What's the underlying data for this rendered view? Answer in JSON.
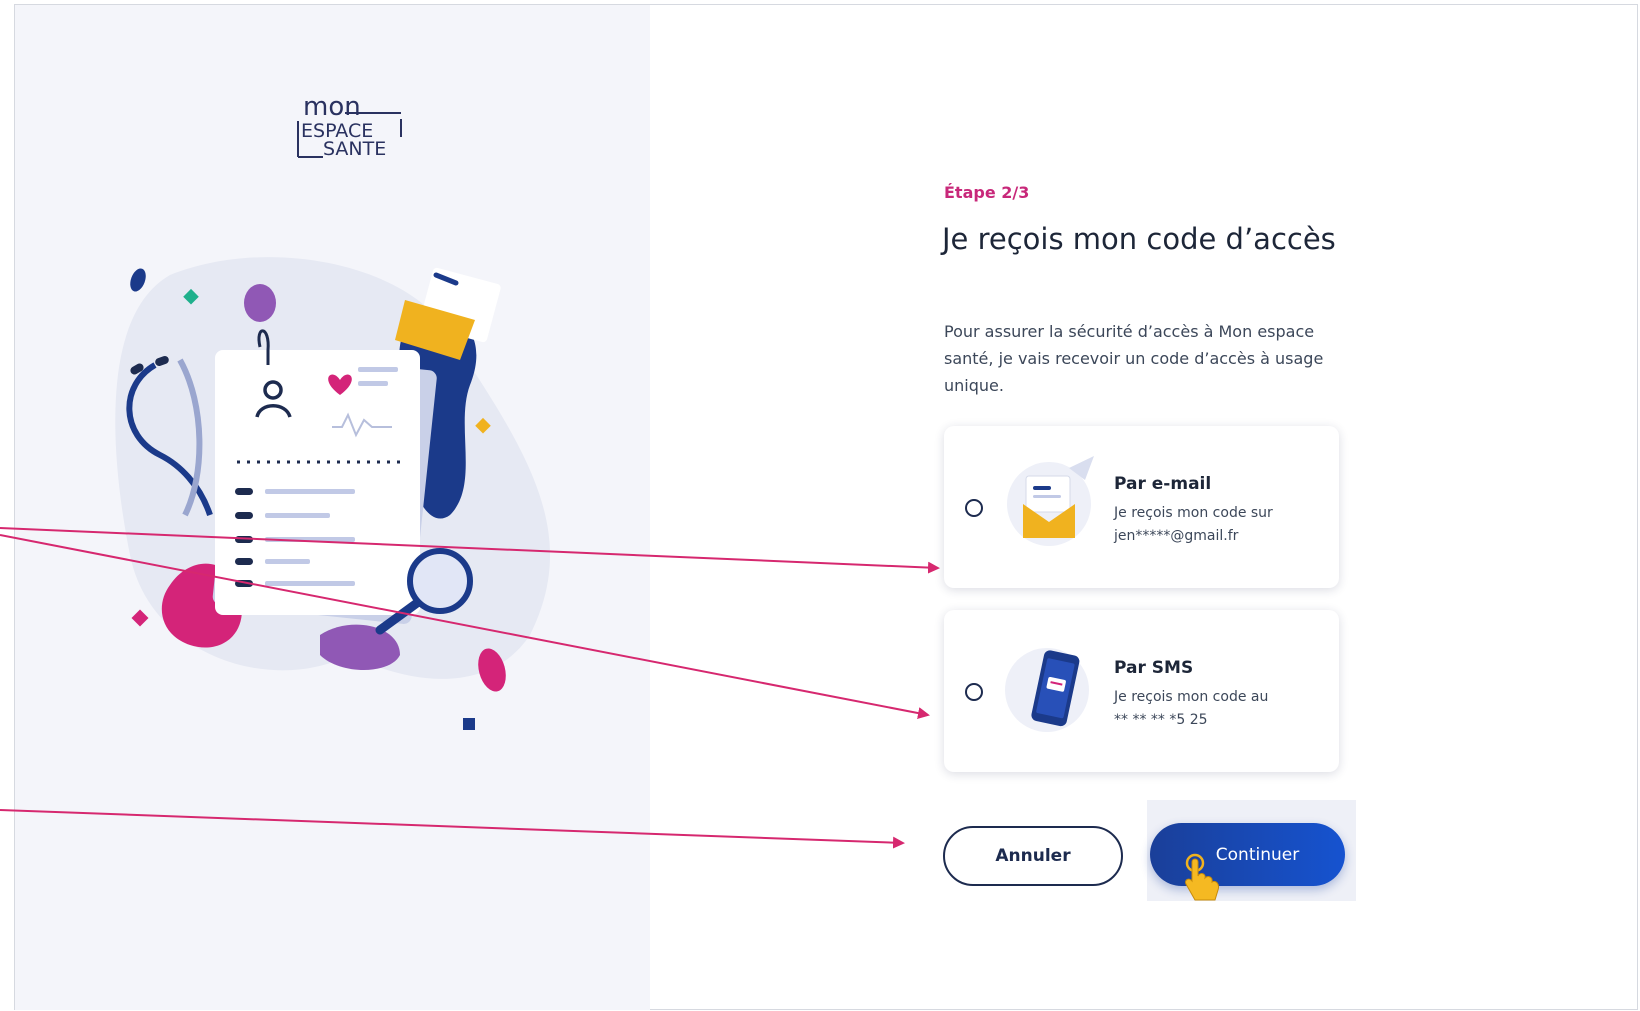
{
  "brand": {
    "logo_line1": "mon",
    "logo_line2": "ESPACE",
    "logo_line3": "SANTE"
  },
  "form": {
    "step": "Étape 2/3",
    "title": "Je reçois mon code d’accès",
    "description": "Pour assurer la sécurité d’accès à Mon espace santé, je vais recevoir un code d’accès à usage unique."
  },
  "options": [
    {
      "title": "Par e-mail",
      "desc_line1": "Je reçois mon code sur",
      "desc_line2": "jen*****@gmail.fr",
      "icon": "envelope-icon"
    },
    {
      "title": "Par SMS",
      "desc_line1": "Je reçois mon code au",
      "desc_line2": "** ** ** *5 25",
      "icon": "smartphone-icon"
    }
  ],
  "actions": {
    "cancel_label": "Annuler",
    "continue_label": "Continuer"
  },
  "colors": {
    "accent_pink": "#c8287a",
    "navy": "#1d2b4f",
    "button_blue": "#1653d0",
    "annotation_arrow": "#d6286f"
  }
}
